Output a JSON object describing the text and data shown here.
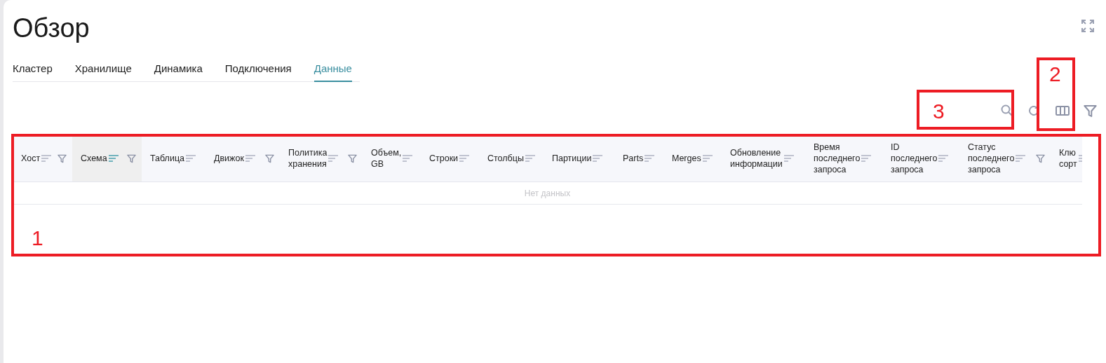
{
  "title": "Обзор",
  "tabs": [
    {
      "label": "Кластер",
      "selected": false
    },
    {
      "label": "Хранилище",
      "selected": false
    },
    {
      "label": "Динамика",
      "selected": false
    },
    {
      "label": "Подключения",
      "selected": false
    },
    {
      "label": "Данные",
      "selected": true
    }
  ],
  "table": {
    "columns": [
      {
        "lines": [
          "Хост"
        ],
        "sorted": false,
        "filter": true
      },
      {
        "lines": [
          "Схема"
        ],
        "sorted": true,
        "filter": true
      },
      {
        "lines": [
          "Таблица"
        ],
        "sorted": false,
        "filter": false
      },
      {
        "lines": [
          "Движок"
        ],
        "sorted": false,
        "filter": true
      },
      {
        "lines": [
          "Политика",
          "хранения"
        ],
        "sorted": false,
        "filter": true
      },
      {
        "lines": [
          "Объем,",
          "GB"
        ],
        "sorted": false,
        "filter": false
      },
      {
        "lines": [
          "Строки"
        ],
        "sorted": false,
        "filter": false
      },
      {
        "lines": [
          "Столбцы"
        ],
        "sorted": false,
        "filter": false
      },
      {
        "lines": [
          "Партиции"
        ],
        "sorted": false,
        "filter": false
      },
      {
        "lines": [
          "Parts"
        ],
        "sorted": false,
        "filter": false
      },
      {
        "lines": [
          "Merges"
        ],
        "sorted": false,
        "filter": false
      },
      {
        "lines": [
          "Обновление",
          "информации"
        ],
        "sorted": false,
        "filter": false
      },
      {
        "lines": [
          "Время",
          "последнего",
          "запроса"
        ],
        "sorted": false,
        "filter": false
      },
      {
        "lines": [
          "ID",
          "последнего",
          "запроса"
        ],
        "sorted": false,
        "filter": false
      },
      {
        "lines": [
          "Статус",
          "последнего",
          "запроса"
        ],
        "sorted": false,
        "filter": true
      },
      {
        "lines": [
          "Клю",
          "сорт"
        ],
        "sorted": false,
        "filter": false
      }
    ],
    "empty_text": "Нет данных"
  },
  "annotations": [
    {
      "label": "1"
    },
    {
      "label": "2"
    },
    {
      "label": "3"
    }
  ]
}
